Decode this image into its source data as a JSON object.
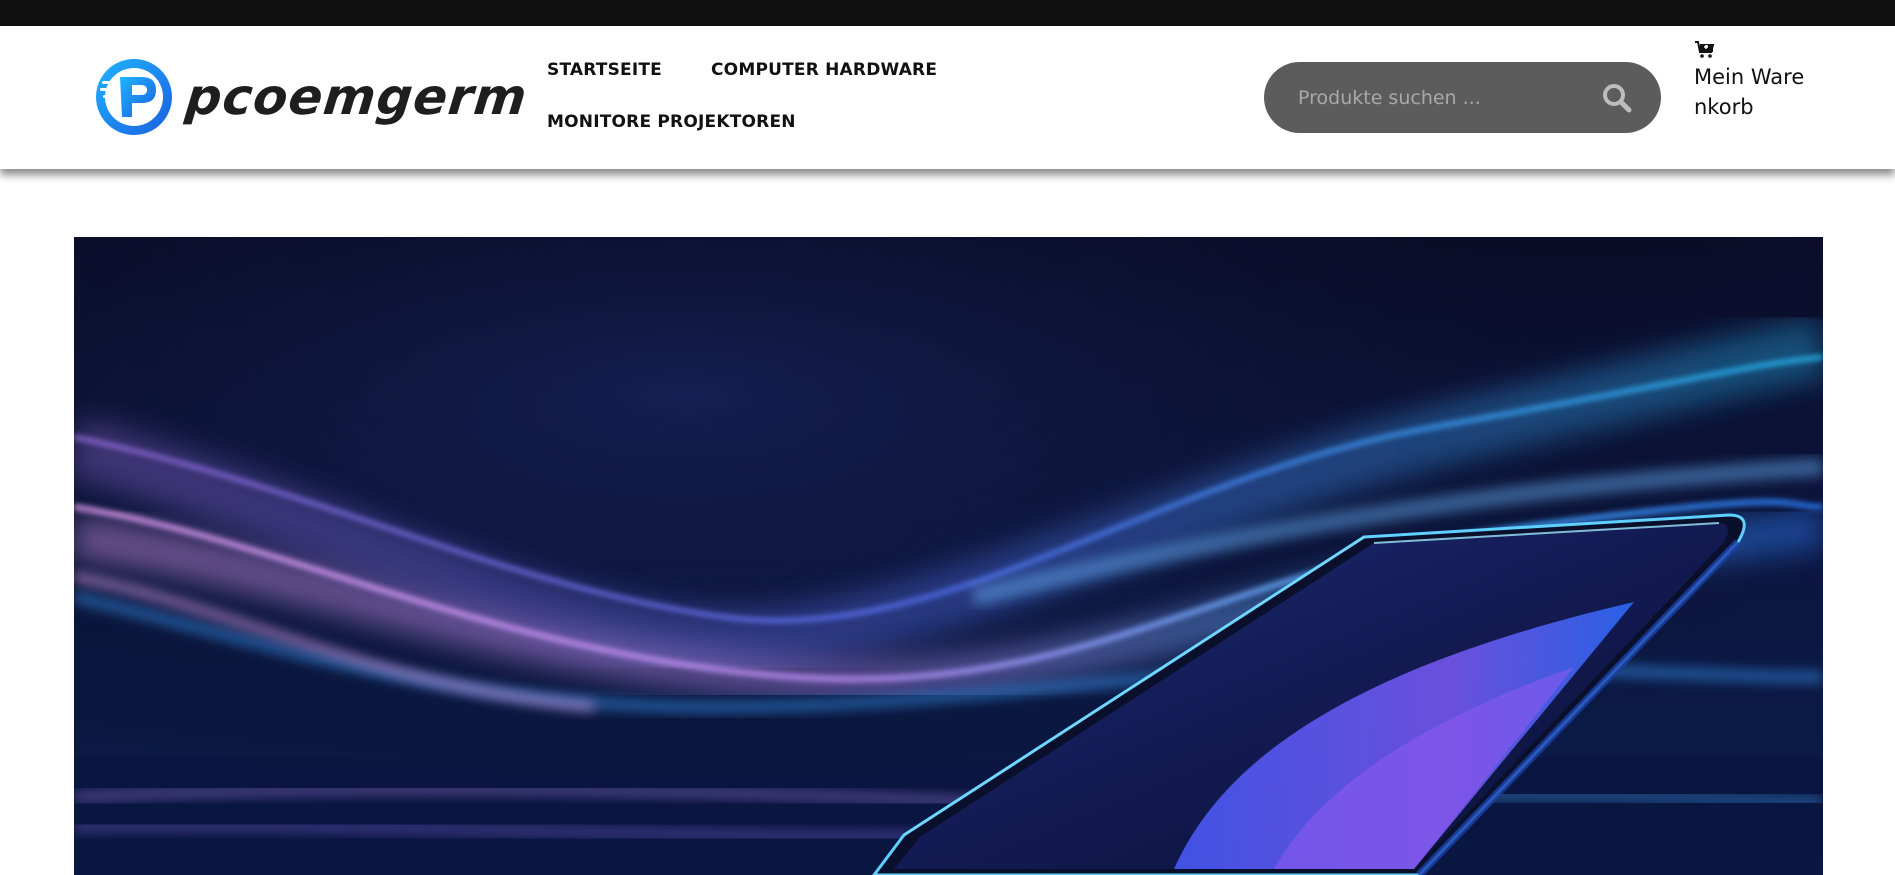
{
  "brand": {
    "name": "pcoemgerm",
    "logo_icon": "pcoemgerm-logo-icon",
    "accent_color": "#1e8bff"
  },
  "nav": {
    "items": [
      {
        "label": "STARTSEITE"
      },
      {
        "label": "COMPUTER HARDWARE"
      },
      {
        "label": "MONITORE PROJEKTOREN"
      }
    ]
  },
  "search": {
    "placeholder": "Produkte suchen ...",
    "value": "",
    "icon": "search-icon"
  },
  "cart": {
    "label": "Mein Warenkorb",
    "icon": "cart-icon"
  },
  "hero": {
    "image": "smartphone-light-waves-banner",
    "colors": {
      "background": "#060818",
      "wave_purple": "#b27be6",
      "wave_blue": "#3aa0ff"
    }
  }
}
